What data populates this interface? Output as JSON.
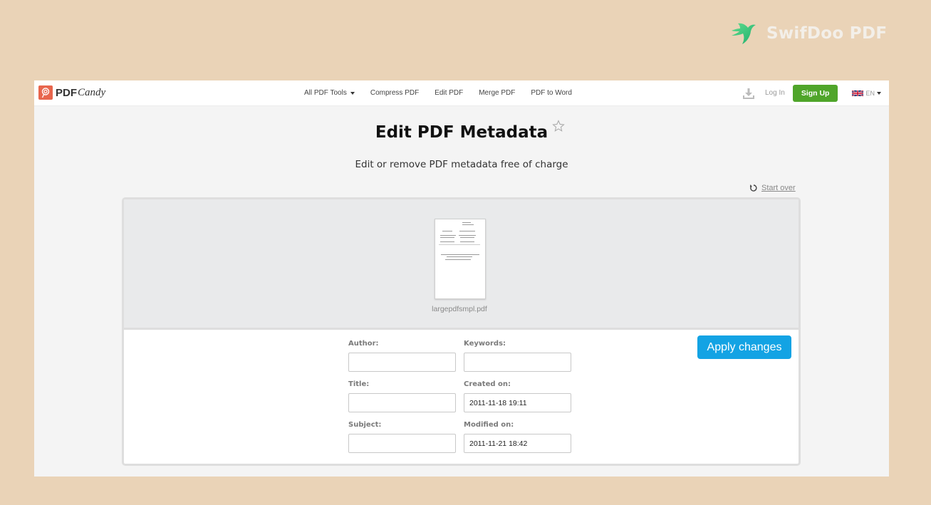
{
  "watermark": {
    "brand": "SwifDoo PDF",
    "accent": "#2fc58b"
  },
  "navbar": {
    "logo": {
      "primary": "PDF",
      "secondary": "Candy",
      "color": "#e8664d"
    },
    "links": [
      {
        "label": "All PDF Tools",
        "has_dropdown": true
      },
      {
        "label": "Compress PDF"
      },
      {
        "label": "Edit PDF"
      },
      {
        "label": "Merge PDF"
      },
      {
        "label": "PDF to Word"
      }
    ],
    "login_label": "Log In",
    "signup_label": "Sign Up",
    "signup_color": "#4fa52a",
    "language": "EN"
  },
  "page": {
    "title": "Edit PDF Metadata",
    "subtitle": "Edit or remove PDF metadata free of charge",
    "start_over_label": "Start over"
  },
  "file": {
    "name": "largepdfsmpl.pdf"
  },
  "form": {
    "author": {
      "label": "Author:",
      "value": ""
    },
    "keywords": {
      "label": "Keywords:",
      "value": ""
    },
    "title": {
      "label": "Title:",
      "value": ""
    },
    "created": {
      "label": "Created on:",
      "value": "2011-11-18 19:11"
    },
    "subject": {
      "label": "Subject:",
      "value": ""
    },
    "modified": {
      "label": "Modified on:",
      "value": "2011-11-21 18:42"
    },
    "apply_label": "Apply changes",
    "apply_color": "#13a3e4"
  }
}
